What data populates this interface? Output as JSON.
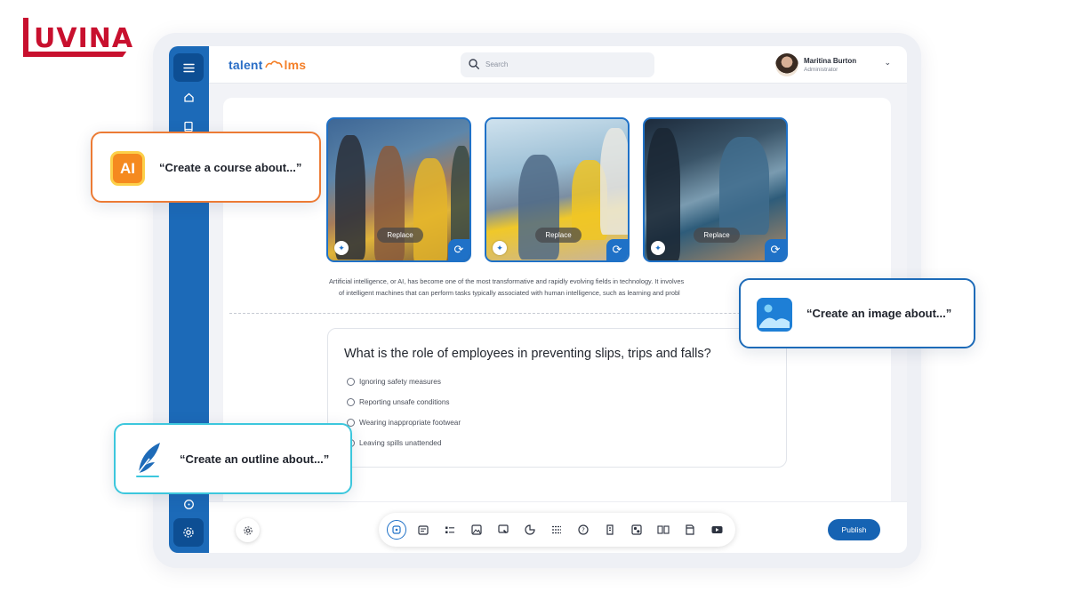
{
  "brand": {
    "name": "UVINA"
  },
  "app": {
    "logo_a": "talent",
    "logo_b": "lms",
    "search_placeholder": "Search",
    "user": {
      "name": "Maritina Burton",
      "role": "Administrator"
    }
  },
  "images": [
    {
      "replace_label": "Replace"
    },
    {
      "replace_label": "Replace"
    },
    {
      "replace_label": "Replace"
    }
  ],
  "content": {
    "text_line1": "Artificial intelligence, or AI, has become one of the most transformative and rapidly evolving fields in technology. It involves",
    "text_line2": "of intelligent machines that can perform tasks typically associated with human intelligence, such as learning and probl"
  },
  "quiz": {
    "question": "What is the role of employees in preventing slips, trips and falls?",
    "options": [
      "Ignoring safety measures",
      "Reporting unsafe conditions",
      "Wearing inappropriate footwear",
      "Leaving spills unattended"
    ]
  },
  "toolbar": {
    "publish_label": "Publish",
    "tools": [
      "ai-tool",
      "text-tool",
      "list-tool",
      "image-tool",
      "screen-tool",
      "chart-tool",
      "menu-tool",
      "question-tool",
      "assignment-tool",
      "media-tool",
      "compare-tool",
      "document-tool",
      "video-tool"
    ]
  },
  "callouts": {
    "course": "“Create a course about...”",
    "image": "“Create an image about...”",
    "outline": "“Create an outline about...”",
    "ai_badge": "AI"
  },
  "colors": {
    "sidebar": "#1c6ab8",
    "primary": "#1663b3",
    "orange_accent": "#ec7b35",
    "cyan_accent": "#3cc7dd",
    "brand_red": "#c8102e"
  }
}
